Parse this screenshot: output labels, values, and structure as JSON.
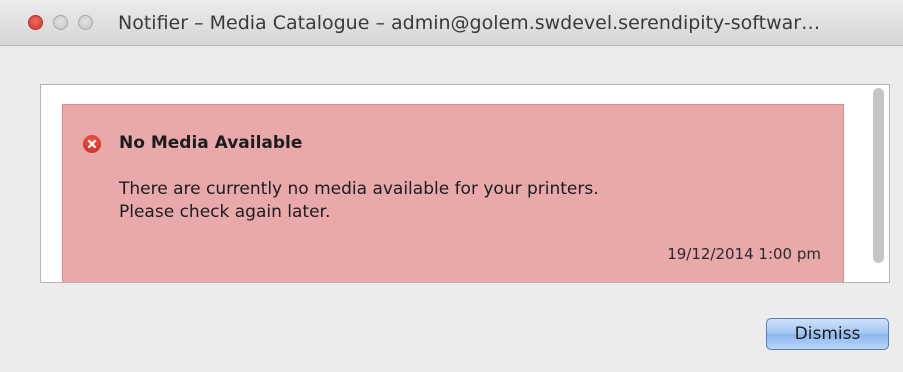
{
  "window": {
    "title": "Notifier – Media Catalogue – admin@golem.swdevel.serendipity-softwar…"
  },
  "notifications": [
    {
      "severity_icon": "error-icon",
      "title": "No Media Available",
      "message_line1": "There are currently no media available for your printers.",
      "message_line2": "Please check again later.",
      "timestamp": "19/12/2014 1:00 pm",
      "background_color": "#e9a9ab"
    }
  ],
  "footer": {
    "dismiss_label": "Dismiss"
  }
}
